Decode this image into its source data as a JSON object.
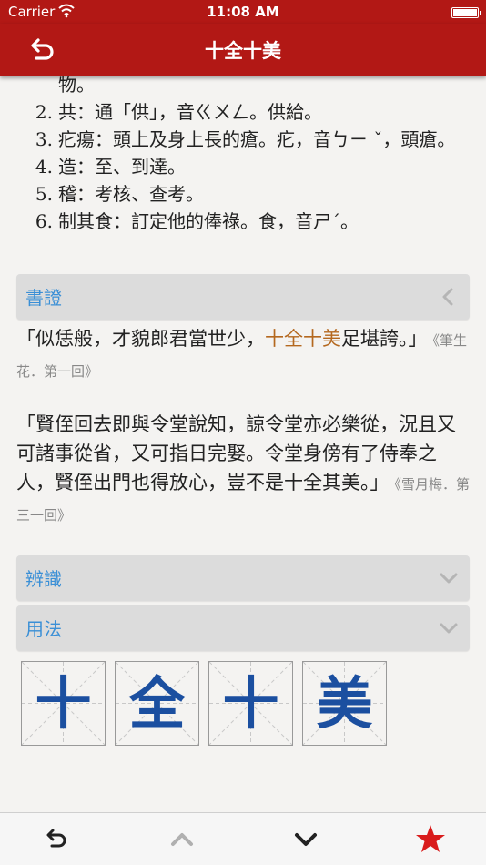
{
  "status": {
    "carrier": "Carrier",
    "time": "11:08 AM"
  },
  "nav": {
    "title": "十全十美",
    "back_icon": "back-arrow-icon"
  },
  "notes": [
    {
      "num": "",
      "text": "物。"
    },
    {
      "num": "2.",
      "text": "共：通「供」，音ㄍㄨㄥ。供給。"
    },
    {
      "num": "3.",
      "text": "疕瘍：頭上及身上長的瘡。疕，音ㄅㄧ ˇ，頭瘡。"
    },
    {
      "num": "4.",
      "text": "造：至、到達。"
    },
    {
      "num": "5.",
      "text": "稽：考核、查考。"
    },
    {
      "num": "6.",
      "text": "制其食：訂定他的俸祿。食，音ㄕˊ。"
    }
  ],
  "sections": {
    "shuzheng": {
      "label": "書證"
    },
    "bianshi": {
      "label": "辨識"
    },
    "yongfa": {
      "label": "用法"
    }
  },
  "quotes": [
    {
      "pre": "「似恁般，才貌郎君當世少，",
      "hl": "十全十美",
      "post": "足堪誇。」",
      "src": "《筆生花．第一回》"
    },
    {
      "pre": "「賢侄回去即與令堂說知，諒令堂亦必樂從，況且又可諸事從省，又可指日完娶。令堂身傍有了侍奉之人，賢侄出門也得放心，豈不是十全其美。」",
      "hl": "",
      "post": "",
      "src": "《雪月梅．第三一回》"
    }
  ],
  "chars": [
    "十",
    "全",
    "十",
    "美"
  ],
  "colors": {
    "accent": "#b21815",
    "link": "#3a8fd6",
    "highlight": "#b4681f",
    "char": "#1b4fa0",
    "star": "#d91c1c"
  },
  "toolbar": {
    "back": "back-icon",
    "up": "chevron-up-icon",
    "down": "chevron-down-icon",
    "favorite": "star-icon"
  }
}
